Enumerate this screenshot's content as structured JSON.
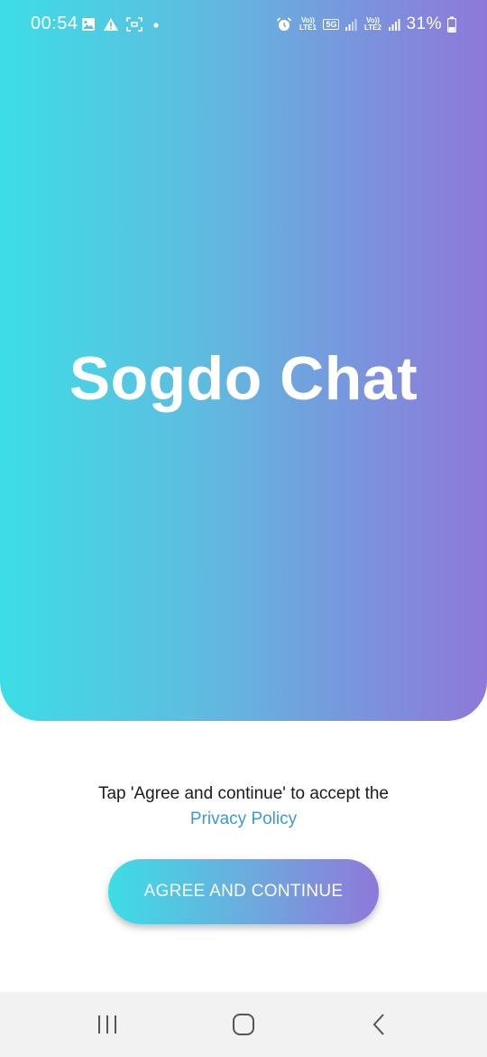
{
  "status_bar": {
    "time": "00:54",
    "battery": "31%",
    "net_1": "Vo)) LTE1",
    "net_5g": "5G",
    "net_2": "Vo)) LTE2",
    "icons_left": [
      "gallery-icon",
      "warning-icon",
      "screen-capture-icon",
      "dot-icon"
    ],
    "icons_right": [
      "alarm-icon",
      "signal-icon",
      "signal-icon",
      "battery-icon"
    ]
  },
  "hero": {
    "title": "Sogdo Chat",
    "gradient_start": "#3ddde5",
    "gradient_end": "#8f78d9"
  },
  "consent": {
    "text": "Tap 'Agree and continue' to accept the",
    "link": "Privacy Policy",
    "link_color": "#3a9ad6"
  },
  "agree_button": {
    "label": "AGREE AND CONTINUE"
  },
  "nav_bar": {
    "buttons": [
      "recent-apps-icon",
      "home-icon",
      "back-icon"
    ]
  }
}
